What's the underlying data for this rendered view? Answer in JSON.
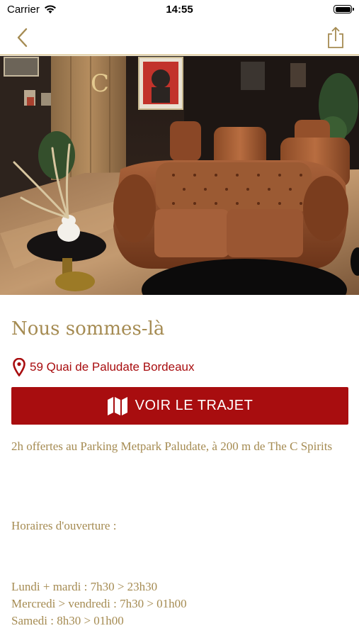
{
  "status_bar": {
    "carrier": "Carrier",
    "time": "14:55"
  },
  "nav": {
    "back_icon": "chevron-left-icon",
    "share_icon": "share-icon",
    "accent": "#a58b52"
  },
  "hero": {
    "description_icon": "lounge-photo",
    "logo_letter": "C"
  },
  "location": {
    "title": "Nous sommes-là",
    "address": "59 Quai de Paludate Bordeaux",
    "route_button": "VOIR LE TRAJET",
    "parking_note": "2h offertes au Parking Metpark Paludate, à 200 m de The C Spirits"
  },
  "hours": {
    "heading": "Horaires d'ouverture :",
    "lines": [
      "Lundi + mardi : 7h30 > 23h30",
      "Mercredi > vendredi : 7h30 > 01h00",
      "Samedi : 8h30 > 01h00"
    ]
  },
  "colors": {
    "gold": "#a58b52",
    "red": "#a80d0f",
    "background": "#ffffff"
  }
}
